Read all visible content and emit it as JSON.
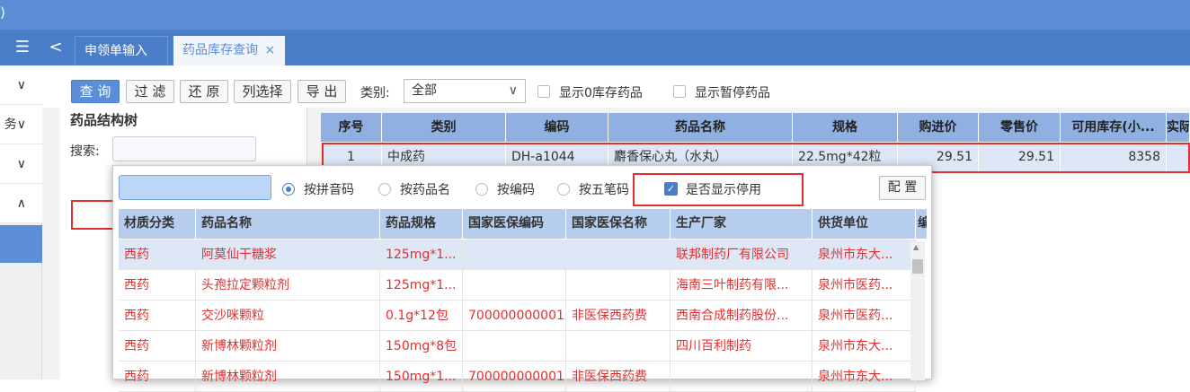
{
  "titlebar": {
    "text": ")"
  },
  "leftnav": {
    "menu_icon": "☰",
    "items": [
      {
        "label": "∨"
      },
      {
        "label": "务∨"
      },
      {
        "label": "∨"
      },
      {
        "label": "∧"
      }
    ]
  },
  "tabs": {
    "back": "<",
    "items": [
      {
        "label": "申领单输入",
        "close": "×"
      },
      {
        "label": "药品库存查询",
        "close": "×"
      }
    ]
  },
  "toolbar": {
    "query": "查 询",
    "filter": "过 滤",
    "restore": "还 原",
    "columns": "列选择",
    "export": "导 出",
    "category_label": "类别:",
    "category_value": "全部",
    "show_zero_stock": "显示0库存药品",
    "show_suspended": "显示暂停药品"
  },
  "tree": {
    "title": "药品结构树",
    "search_label": "搜索:"
  },
  "grid": {
    "headers": [
      "序号",
      "类别",
      "编码",
      "药品名称",
      "规格",
      "购进价",
      "零售价",
      "可用库存(小...",
      "实际"
    ],
    "rows": [
      [
        "1",
        "中成药",
        "DH-a1044",
        "麝香保心丸（水丸）",
        "22.5mg*42粒",
        "29.51",
        "29.51",
        "8358",
        ""
      ]
    ]
  },
  "popup": {
    "search_value": "",
    "radio_pinyin": "按拼音码",
    "radio_name": "按药品名",
    "radio_code": "按编码",
    "radio_wubi": "按五笔码",
    "show_disabled": "是否显示停用",
    "config": "配 置",
    "headers": [
      "材质分类",
      "药品名称",
      "药品规格",
      "国家医保编码",
      "国家医保名称",
      "生产厂家",
      "供货单位",
      "编"
    ],
    "rows": [
      [
        "西药",
        "阿莫仙干糖浆",
        "125mg*1...",
        "",
        "",
        "联邦制药厂有限公司",
        "泉州市东大..."
      ],
      [
        "西药",
        "头孢拉定颗粒剂",
        "125mg*1...",
        "",
        "",
        "海南三叶制药有限...",
        "泉州市医药..."
      ],
      [
        "西药",
        "交沙咪颗粒",
        "0.1g*12包",
        "700000000001",
        "非医保西药费",
        "西南合成制药股份...",
        "泉州市医药..."
      ],
      [
        "西药",
        "新博林颗粒剂",
        "150mg*8包",
        "",
        "",
        "四川百利制药",
        "泉州市东大..."
      ],
      [
        "西药",
        "新博林颗粒剂",
        "150mg*1...",
        "700000000001",
        "非医保西药费",
        "",
        "泉州市东大..."
      ]
    ]
  }
}
